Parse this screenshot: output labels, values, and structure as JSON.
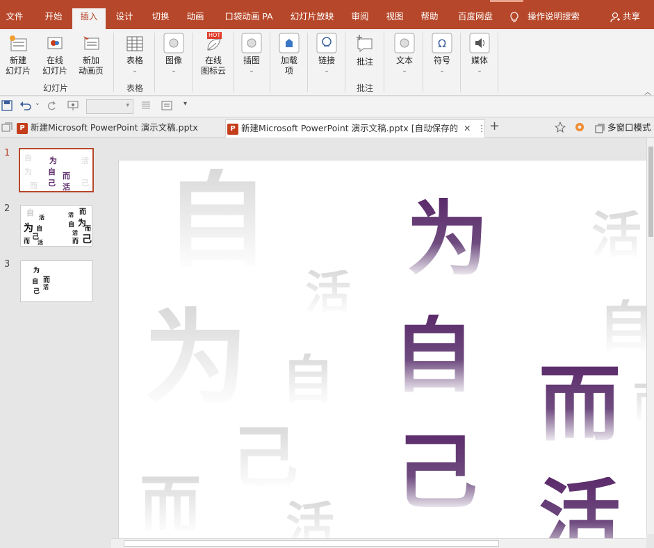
{
  "ribbon_tabs": [
    "文件",
    "开始",
    "插入",
    "设计",
    "切换",
    "动画",
    "口袋动画 PA",
    "幻灯片放映",
    "审阅",
    "视图",
    "帮助",
    "百度网盘"
  ],
  "active_tab": "插入",
  "tell_me": "操作说明搜索",
  "share": "共享",
  "ribbon": {
    "new_slide": "新建\n幻灯片",
    "online_slide": "在线\n幻灯片",
    "new_anim_page": "新加\n动画页",
    "group_slides": "幻灯片",
    "table": "表格",
    "group_table": "表格",
    "image": "图像",
    "online_icons": "在线\n图标云",
    "hot_badge": "HOT",
    "illustration": "插图",
    "addins": "加载\n项",
    "links": "链接",
    "comment": "批注",
    "group_comment": "批注",
    "text": "文本",
    "symbols": "符号",
    "media": "媒体"
  },
  "doc_tabs": [
    {
      "title": "新建Microsoft PowerPoint 演示文稿.pptx",
      "active": false
    },
    {
      "title": "新建Microsoft PowerPoint 演示文稿.pptx [自动保存的",
      "active": true
    }
  ],
  "window_mode": "多窗口模式",
  "slides": [
    {
      "number": "1",
      "selected": true
    },
    {
      "number": "2",
      "selected": false
    },
    {
      "number": "3",
      "selected": false
    }
  ],
  "thumb_chars": {
    "t1": [
      "为",
      "自",
      "己",
      "而",
      "活",
      "自",
      "为",
      "己",
      "而",
      "活"
    ],
    "t2": [
      "自",
      "活",
      "为",
      "自",
      "己",
      "而",
      "活",
      "而",
      "活",
      "自",
      "为",
      "而",
      "活",
      "而",
      "己"
    ],
    "t3": [
      "为",
      "自",
      "而",
      "活",
      "己"
    ]
  },
  "slide_text": {
    "fg": [
      "为",
      "自",
      "己",
      "而",
      "活"
    ],
    "bg": [
      "自",
      "活",
      "为",
      "自",
      "己",
      "而",
      "活",
      "活",
      "自",
      "而"
    ]
  },
  "colors": {
    "ribbon_brand": "#b7472a",
    "text_gradient_top": "#5b2a6a"
  }
}
